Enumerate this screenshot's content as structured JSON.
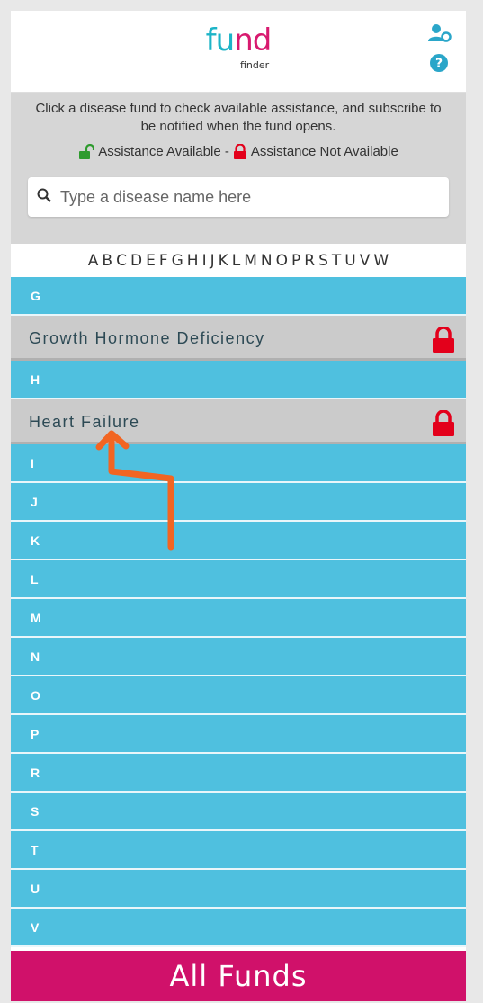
{
  "header": {
    "logo_part1": "fu",
    "logo_part2": "nd",
    "logo_sub": "finder",
    "user_icon": "user-settings-icon",
    "help_icon": "question-circle-icon",
    "brand_colors": {
      "teal": "#1db4c7",
      "pink": "#d81a6f"
    }
  },
  "info": {
    "instructions": "Click a disease fund to check available assistance, and subscribe to be notified when the fund opens.",
    "legend_available": "Assistance Available - ",
    "legend_not_available": "Assistance Not Available",
    "available_color": "#2e9b2e",
    "not_available_color": "#e3001b"
  },
  "search": {
    "placeholder": "Type a disease name here",
    "value": ""
  },
  "alphabet": [
    "A",
    "B",
    "C",
    "D",
    "E",
    "F",
    "G",
    "H",
    "I",
    "J",
    "K",
    "L",
    "M",
    "N",
    "O",
    "P",
    "R",
    "S",
    "T",
    "U",
    "V",
    "W"
  ],
  "list": {
    "g_letter": "G",
    "g_fund": "Growth Hormone Deficiency",
    "h_letter": "H",
    "h_fund": "Heart Failure",
    "letters_after": [
      "I",
      "J",
      "K",
      "L",
      "M",
      "N",
      "O",
      "P",
      "R",
      "S",
      "T",
      "U",
      "V"
    ]
  },
  "footer": {
    "all_funds_label": "All Funds"
  },
  "colors": {
    "section_bg": "#4fc0df",
    "footer_bg": "#d0116a",
    "annotation_arrow": "#f26522"
  }
}
